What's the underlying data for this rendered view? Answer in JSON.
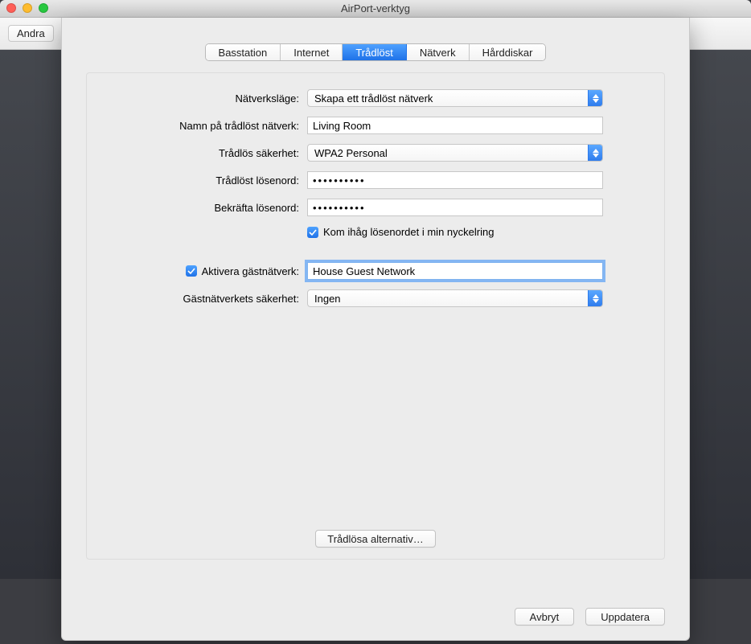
{
  "window": {
    "title": "AirPort-verktyg",
    "toolbar_button": "Andra"
  },
  "tabs": {
    "items": [
      "Basstation",
      "Internet",
      "Trådlöst",
      "Nätverk",
      "Hårddiskar"
    ],
    "selected_index": 2
  },
  "form": {
    "network_mode_label": "Nätverksläge:",
    "network_mode_value": "Skapa ett trådlöst nätverk",
    "network_name_label": "Namn på trådlöst nätverk:",
    "network_name_value": "Living Room",
    "security_label": "Trådlös säkerhet:",
    "security_value": "WPA2 Personal",
    "password_label": "Trådlöst lösenord:",
    "password_value": "••••••••••",
    "confirm_label": "Bekräfta lösenord:",
    "confirm_value": "••••••••••",
    "remember_keychain_label": "Kom ihåg lösenordet i min nyckelring",
    "remember_keychain_checked": true,
    "enable_guest_label": "Aktivera gästnätverk:",
    "enable_guest_checked": true,
    "guest_name_value": "House Guest Network",
    "guest_security_label": "Gästnätverkets säkerhet:",
    "guest_security_value": "Ingen",
    "wireless_options_button": "Trådlösa alternativ…"
  },
  "footer": {
    "cancel": "Avbryt",
    "update": "Uppdatera"
  }
}
